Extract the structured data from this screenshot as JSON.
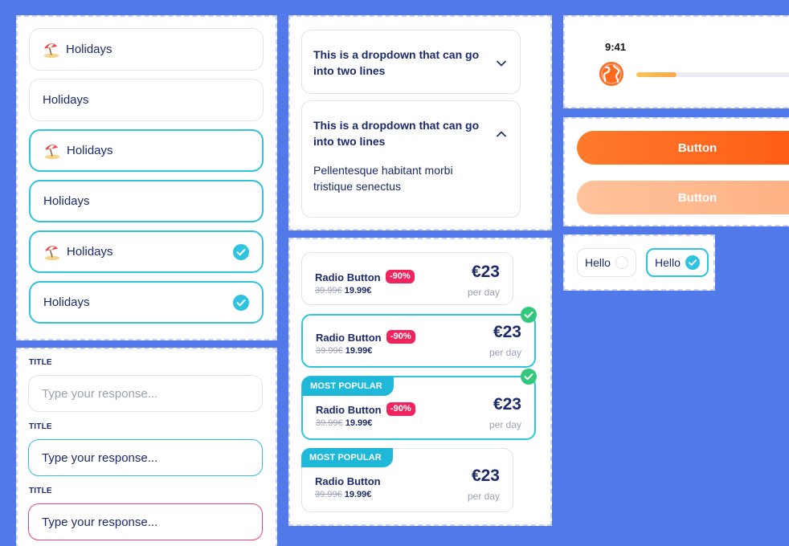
{
  "colors": {
    "background": "#5179ea",
    "accent": "#2fc3df",
    "error": "#f0427a",
    "primary_button": "#ff6a1f",
    "badge": "#f0245e",
    "check_green": "#34c77b"
  },
  "select_list": {
    "items": [
      {
        "label": "Holidays",
        "icon": "beach-umbrella-icon",
        "state": "default",
        "checked": false
      },
      {
        "label": "Holidays",
        "icon": null,
        "state": "default",
        "checked": false
      },
      {
        "label": "Holidays",
        "icon": "beach-umbrella-icon",
        "state": "active",
        "checked": false
      },
      {
        "label": "Holidays",
        "icon": null,
        "state": "active",
        "checked": false
      },
      {
        "label": "Holidays",
        "icon": "beach-umbrella-icon",
        "state": "active",
        "checked": true
      },
      {
        "label": "Holidays",
        "icon": null,
        "state": "active",
        "checked": true
      }
    ]
  },
  "text_fields": [
    {
      "title": "TITLE",
      "placeholder": "Type your response...",
      "state": "default"
    },
    {
      "title": "TITLE",
      "placeholder": "Type your response...",
      "state": "focused"
    },
    {
      "title": "TITLE",
      "placeholder": "Type your response...",
      "state": "error"
    }
  ],
  "accordions": [
    {
      "title": "This is a dropdown that can go into two lines",
      "expanded": false,
      "chevron": "chevron-down-icon"
    },
    {
      "title": "This is a dropdown that can go into two lines",
      "expanded": true,
      "chevron": "chevron-up-icon",
      "body": "Pellentesque habitant morbi tristique senectus"
    }
  ],
  "price_cards": [
    {
      "title": "Radio Button",
      "badge": "-90%",
      "old_price": "39.99€",
      "new_price": "19.99€",
      "amount": "€23",
      "period": "per day",
      "selected": false,
      "popular": null
    },
    {
      "title": "Radio Button",
      "badge": "-90%",
      "old_price": "39.99€",
      "new_price": "19.99€",
      "amount": "€23",
      "period": "per day",
      "selected": true,
      "popular": null
    },
    {
      "title": "Radio Button",
      "badge": "-90%",
      "old_price": "39.99€",
      "new_price": "19.99€",
      "amount": "€23",
      "period": "per day",
      "selected": true,
      "popular": "MOST POPULAR"
    },
    {
      "title": "Radio Button",
      "badge": null,
      "old_price": "39.99€",
      "new_price": "19.99€",
      "amount": "€23",
      "period": "per day",
      "selected": false,
      "popular": "MOST POPULAR"
    }
  ],
  "progress_widget": {
    "time": "9:41",
    "icon": "globe-icon",
    "progress_fraction": 0.24
  },
  "buttons": [
    {
      "label": "Button",
      "variant": "primary"
    },
    {
      "label": "Button",
      "variant": "soft"
    }
  ],
  "chips": [
    {
      "label": "Hello",
      "selected": false
    },
    {
      "label": "Hello",
      "selected": true
    }
  ]
}
